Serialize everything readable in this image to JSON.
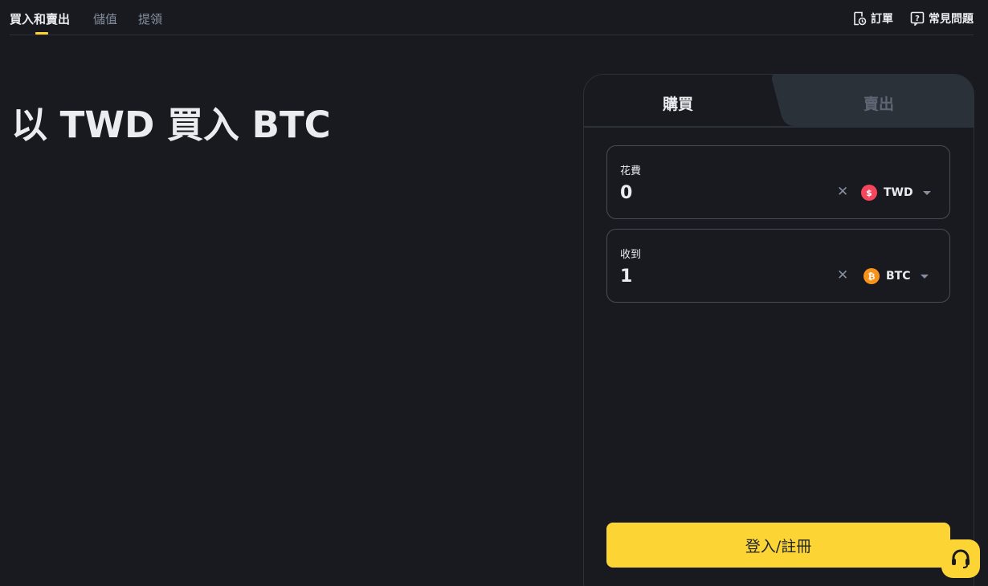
{
  "nav": {
    "tabs": [
      "買入和賣出",
      "儲值",
      "提領"
    ],
    "orders_label": "訂單",
    "faq_label": "常見問題"
  },
  "hero": {
    "title": "以 TWD 買入 BTC"
  },
  "card": {
    "buy_tab": "購買",
    "sell_tab": "賣出",
    "spend": {
      "label": "花費",
      "value": "0",
      "currency": "TWD",
      "icon": "dollar-coin-icon",
      "color": "#f6465d"
    },
    "receive": {
      "label": "收到",
      "value": "1",
      "currency": "BTC",
      "icon": "bitcoin-icon",
      "color": "#f7931a"
    },
    "login_label": "登入/註冊"
  },
  "colors": {
    "accent": "#fcd535",
    "background": "#181a20"
  }
}
